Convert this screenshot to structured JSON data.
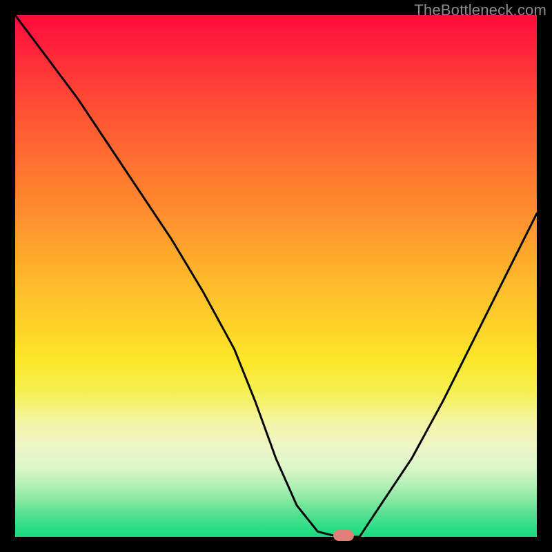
{
  "watermark_text": "TheBottleneck.com",
  "colors": {
    "frame_background": "#000000",
    "curve_stroke": "#000000",
    "marker_fill": "#e08078"
  },
  "chart_data": {
    "type": "line",
    "title": "",
    "xlabel": "",
    "ylabel": "",
    "xlim": [
      0,
      100
    ],
    "ylim": [
      0,
      100
    ],
    "grid": false,
    "series": [
      {
        "name": "bottleneck-curve",
        "x": [
          0,
          6,
          12,
          18,
          24,
          30,
          36,
          42,
          46,
          50,
          54,
          58,
          62,
          66,
          70,
          76,
          82,
          88,
          94,
          100
        ],
        "values": [
          100,
          92,
          84,
          75,
          66,
          57,
          47,
          36,
          26,
          15,
          6,
          1,
          0,
          0,
          6,
          15,
          26,
          38,
          50,
          62
        ]
      }
    ],
    "annotations": [
      {
        "type": "marker",
        "name": "optimal-point",
        "x": 63,
        "y": 0,
        "shape": "rounded-pill"
      }
    ],
    "background_gradient": {
      "direction": "top-to-bottom",
      "stops": [
        {
          "pos": 0,
          "color": "#ff0a3c"
        },
        {
          "pos": 18,
          "color": "#ff5034"
        },
        {
          "pos": 38,
          "color": "#ff8e2e"
        },
        {
          "pos": 58,
          "color": "#ffce2a"
        },
        {
          "pos": 78,
          "color": "#f4f4a6"
        },
        {
          "pos": 93,
          "color": "#86e8a2"
        },
        {
          "pos": 100,
          "color": "#14dc80"
        }
      ]
    }
  }
}
